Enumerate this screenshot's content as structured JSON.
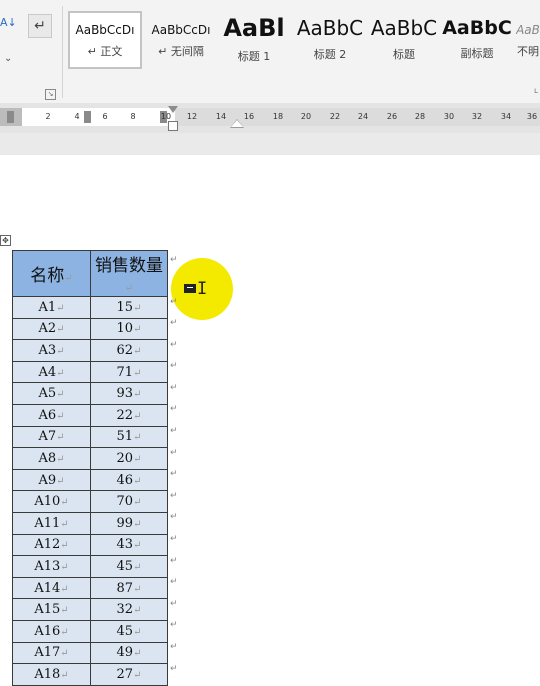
{
  "ribbon": {
    "sort_glyph": "A↓",
    "paragraph_mark_glyph": "↵",
    "styles": [
      {
        "preview": "AaBbCcDı",
        "label": "↵ 正文",
        "selected": true
      },
      {
        "preview": "AaBbCcDı",
        "label": "↵ 无间隔"
      },
      {
        "preview": "AaBl",
        "label": "标题 1"
      },
      {
        "preview": "AaBbC",
        "label": "标题 2"
      },
      {
        "preview": "AaBbC",
        "label": "标题"
      },
      {
        "preview": "AaBbC",
        "label": "副标题"
      },
      {
        "preview": "AaB",
        "label": "不明"
      }
    ]
  },
  "ruler": {
    "numbers": [
      "2",
      "4",
      "6",
      "8",
      "10",
      "12",
      "14",
      "16",
      "18",
      "20",
      "22",
      "24",
      "26",
      "28",
      "30",
      "32",
      "34",
      "36"
    ]
  },
  "table": {
    "headers": [
      "名称",
      "销售数量"
    ],
    "rows": [
      [
        "A1",
        "15"
      ],
      [
        "A2",
        "10"
      ],
      [
        "A3",
        "62"
      ],
      [
        "A4",
        "71"
      ],
      [
        "A5",
        "93"
      ],
      [
        "A6",
        "22"
      ],
      [
        "A7",
        "51"
      ],
      [
        "A8",
        "20"
      ],
      [
        "A9",
        "46"
      ],
      [
        "A10",
        "70"
      ],
      [
        "A11",
        "99"
      ],
      [
        "A12",
        "43"
      ],
      [
        "A13",
        "45"
      ],
      [
        "A14",
        "87"
      ],
      [
        "A15",
        "32"
      ],
      [
        "A16",
        "45"
      ],
      [
        "A17",
        "49"
      ],
      [
        "A18",
        "27"
      ]
    ],
    "cell_end_mark": "↵"
  },
  "colors": {
    "header_fill": "#8db3e2",
    "body_fill": "#dbe5f1",
    "cursor_highlight": "#f4ea00"
  }
}
